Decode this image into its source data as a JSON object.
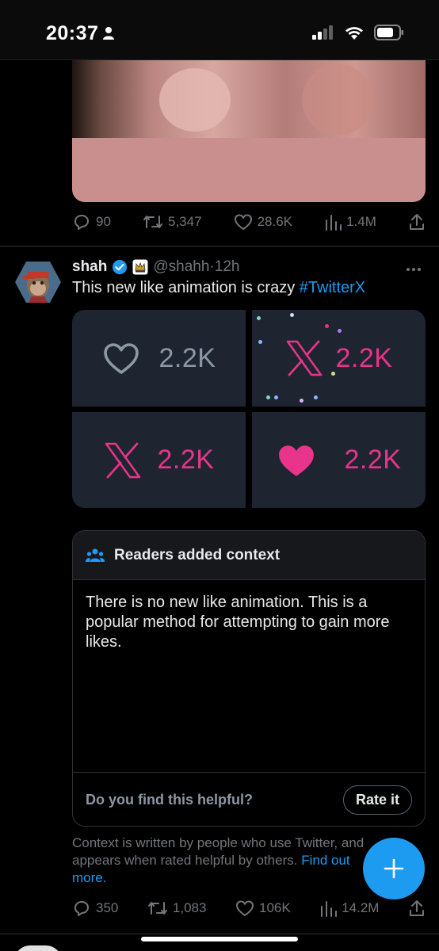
{
  "status_bar": {
    "time": "20:37",
    "icons": [
      "person-icon",
      "signal-icon",
      "wifi-icon",
      "battery-icon"
    ]
  },
  "previous_tweet": {
    "replies": "90",
    "retweets": "5,347",
    "likes": "28.6K",
    "views": "1.4M"
  },
  "tweet": {
    "author_name": "shah",
    "handle": "@shahh",
    "separator": "·",
    "time": "12h",
    "text": "This new like animation is crazy ",
    "hashtag": "#TwitterX",
    "media": {
      "cells": [
        {
          "icon": "heart-outline-icon",
          "count": "2.2K",
          "color": "#8b98a5"
        },
        {
          "icon": "x-logo-icon",
          "count": "2.2K",
          "color": "#e8348a"
        },
        {
          "icon": "x-logo-icon",
          "count": "2.2K",
          "color": "#e8348a"
        },
        {
          "icon": "heart-filled-icon",
          "count": "2.2K",
          "color": "#e8348a"
        }
      ]
    },
    "community_note": {
      "title": "Readers added context",
      "body": "There is no new like animation. This is a popular method for attempting to gain more likes.",
      "question": "Do you find this helpful?",
      "rate_label": "Rate it",
      "disclaimer": "Context is written by people who use Twitter, and appears when rated helpful by others.",
      "find_more": "Find out more."
    },
    "actions": {
      "replies": "350",
      "retweets": "1,083",
      "likes": "106K",
      "views": "14.2M"
    }
  },
  "fab": {
    "icon": "plus-icon"
  },
  "colors": {
    "accent": "#1d9bf0",
    "pink": "#e8348a",
    "muted": "#71767b",
    "card": "#1e2530"
  }
}
